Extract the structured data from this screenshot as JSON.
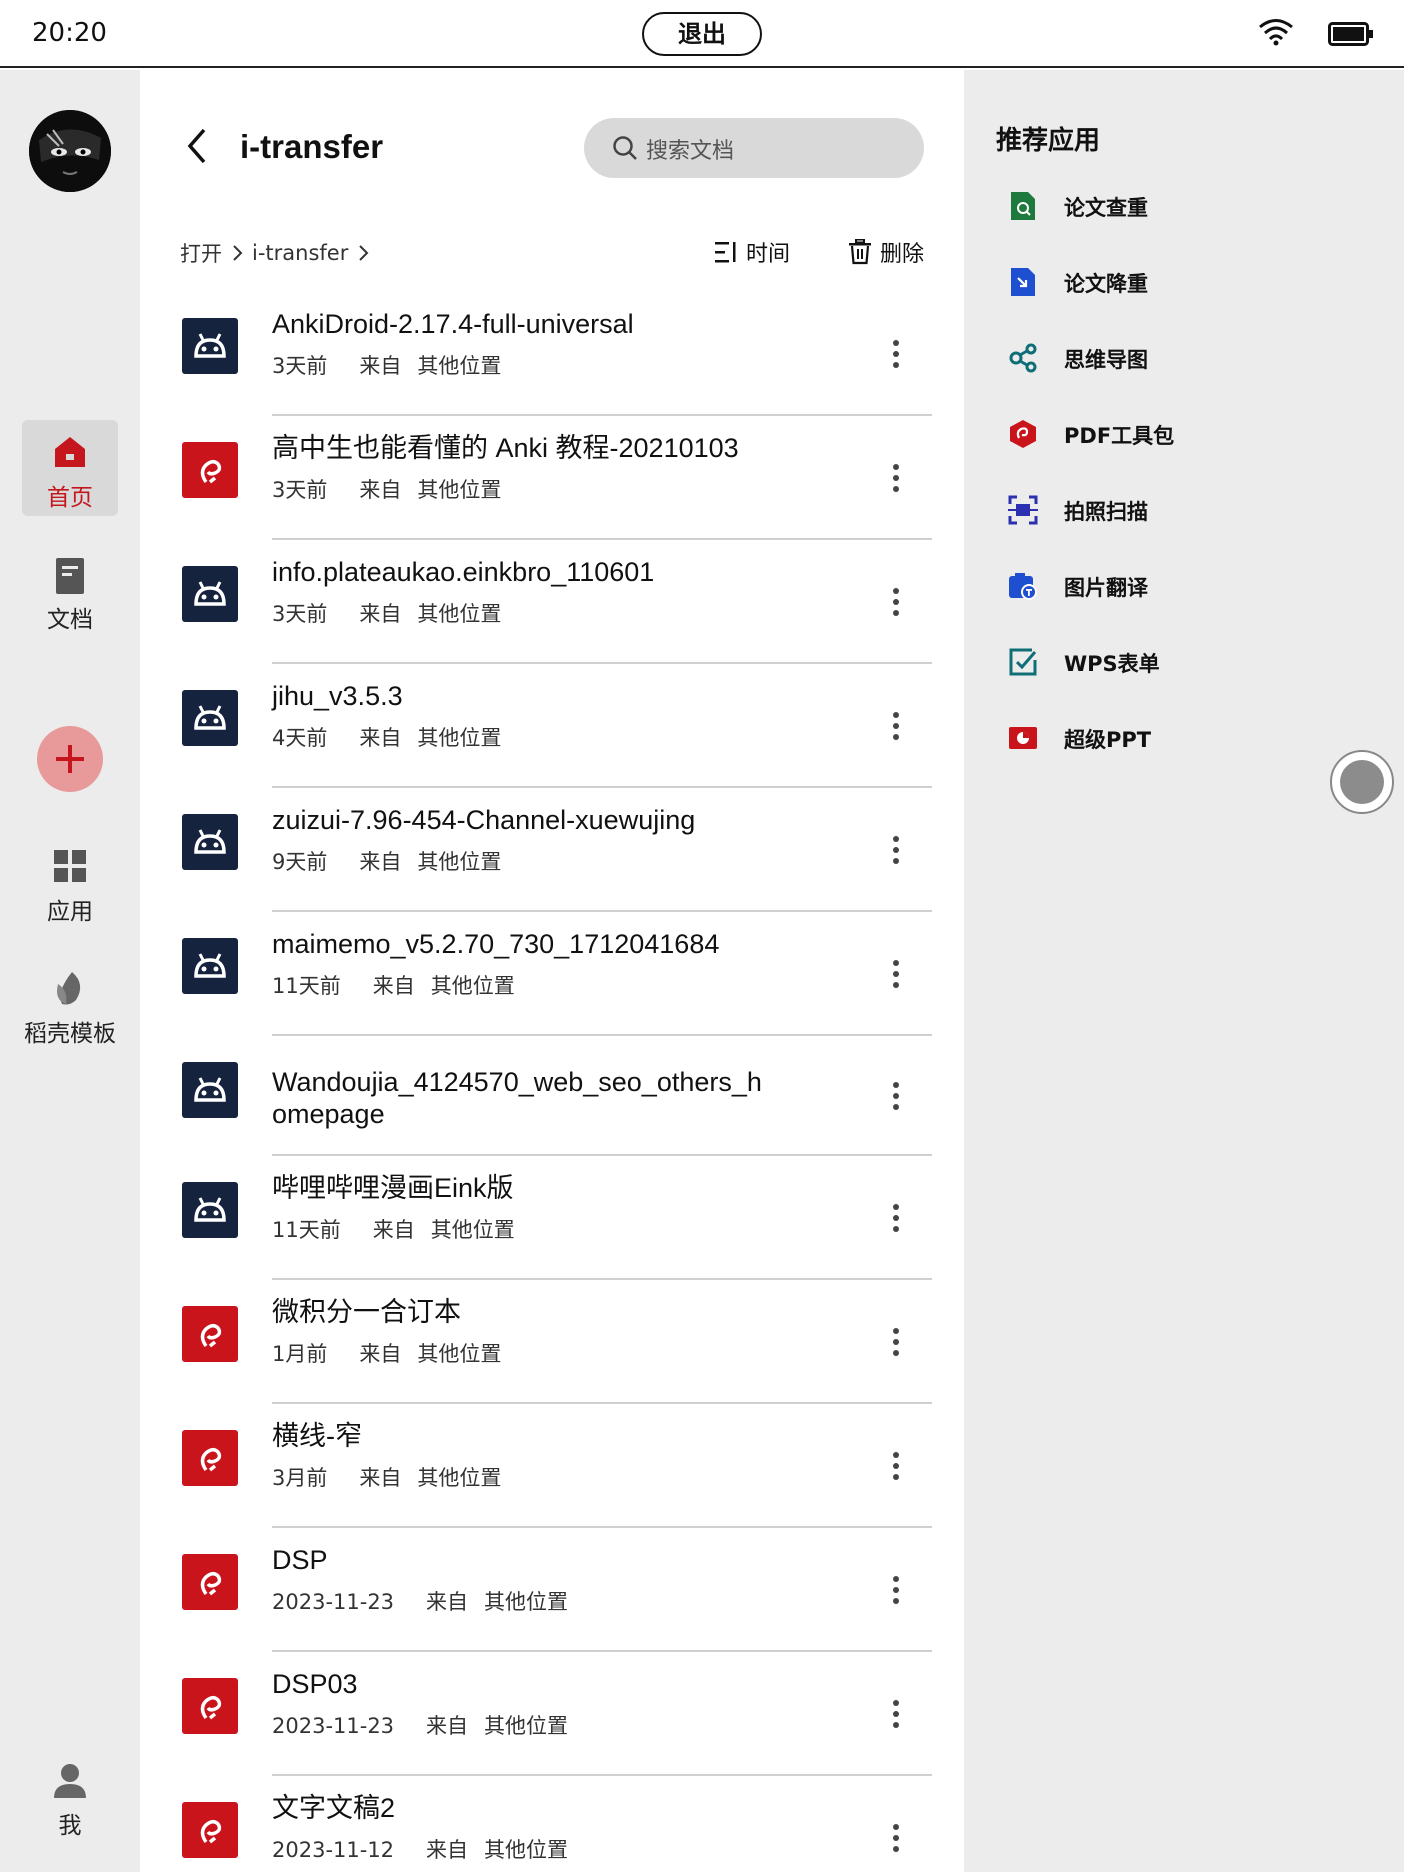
{
  "status_bar": {
    "time": "20:20",
    "exit_label": "退出"
  },
  "nav": {
    "items": [
      {
        "label": "首页",
        "icon": "home-icon",
        "active": true
      },
      {
        "label": "文档",
        "icon": "document-icon"
      },
      {
        "label": "应用",
        "icon": "apps-grid-icon"
      },
      {
        "label": "稻壳模板",
        "icon": "leaf-icon"
      },
      {
        "label": "我",
        "icon": "person-icon"
      }
    ]
  },
  "header": {
    "title": "i-transfer",
    "search_placeholder": "搜索文档"
  },
  "breadcrumb": {
    "items": [
      "打开",
      "i-transfer"
    ]
  },
  "toolbar": {
    "sort_label": "时间",
    "delete_label": "删除"
  },
  "files": [
    {
      "type": "apk",
      "name": "AnkiDroid-2.17.4-full-universal",
      "time": "3天前",
      "from_label": "来自",
      "location": "其他位置"
    },
    {
      "type": "pdf",
      "name": "高中生也能看懂的 Anki 教程-20210103",
      "time": "3天前",
      "from_label": "来自",
      "location": "其他位置"
    },
    {
      "type": "apk",
      "name": "info.plateaukao.einkbro_110601",
      "time": "3天前",
      "from_label": "来自",
      "location": "其他位置"
    },
    {
      "type": "apk",
      "name": "jihu_v3.5.3",
      "time": "4天前",
      "from_label": "来自",
      "location": "其他位置"
    },
    {
      "type": "apk",
      "name": "zuizui-7.96-454-Channel-xuewujing",
      "time": "9天前",
      "from_label": "来自",
      "location": "其他位置"
    },
    {
      "type": "apk",
      "name": "maimemo_v5.2.70_730_1712041684",
      "time": "11天前",
      "from_label": "来自",
      "location": "其他位置"
    },
    {
      "type": "apk",
      "name": "Wandoujia_4124570_web_seo_others_h omepage",
      "time": "",
      "from_label": "",
      "location": ""
    },
    {
      "type": "apk",
      "name": "哔哩哔哩漫画Eink版",
      "time": "11天前",
      "from_label": "来自",
      "location": "其他位置"
    },
    {
      "type": "pdf",
      "name": "微积分一合订本",
      "time": "1月前",
      "from_label": "来自",
      "location": "其他位置"
    },
    {
      "type": "pdf",
      "name": "横线-窄",
      "time": "3月前",
      "from_label": "来自",
      "location": "其他位置"
    },
    {
      "type": "pdf",
      "name": "DSP",
      "time": "2023-11-23",
      "from_label": "来自",
      "location": "其他位置"
    },
    {
      "type": "pdf",
      "name": "DSP03",
      "time": "2023-11-23",
      "from_label": "来自",
      "location": "其他位置"
    },
    {
      "type": "pdf",
      "name": "文字文稿2",
      "time": "2023-11-12",
      "from_label": "来自",
      "location": "其他位置"
    }
  ],
  "recommend": {
    "title": "推荐应用",
    "items": [
      {
        "label": "论文查重",
        "icon": "paper-check-icon",
        "color": "#1e7a3c"
      },
      {
        "label": "论文降重",
        "icon": "paper-reduce-icon",
        "color": "#1f4fd1"
      },
      {
        "label": "思维导图",
        "icon": "mindmap-icon",
        "color": "#0f6e77"
      },
      {
        "label": "PDF工具包",
        "icon": "pdf-toolkit-icon",
        "color": "#c9141b"
      },
      {
        "label": "拍照扫描",
        "icon": "scan-icon",
        "color": "#2c2fb0"
      },
      {
        "label": "图片翻译",
        "icon": "image-translate-icon",
        "color": "#1f4fd1"
      },
      {
        "label": "WPS表单",
        "icon": "form-icon",
        "color": "#0f6e77"
      },
      {
        "label": "超级PPT",
        "icon": "ppt-icon",
        "color": "#c9141b"
      }
    ]
  }
}
